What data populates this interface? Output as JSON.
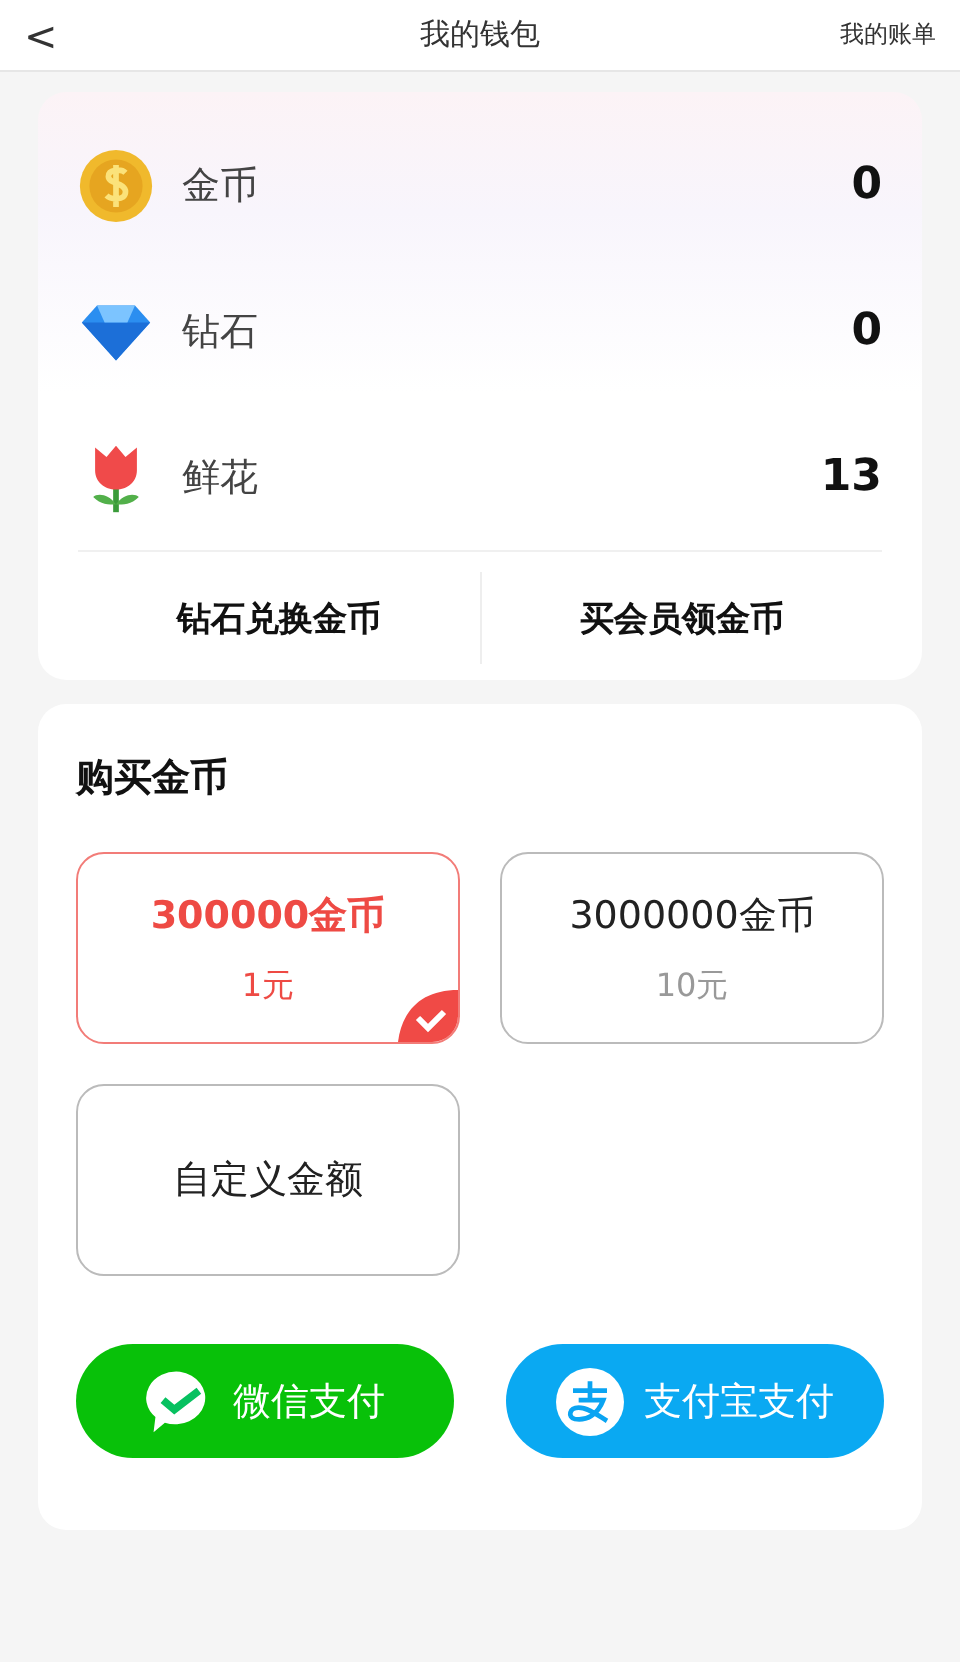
{
  "header": {
    "back": "<",
    "title": "我的钱包",
    "action": "我的账单"
  },
  "balances": [
    {
      "kind": "coin",
      "label": "金币",
      "value": "0"
    },
    {
      "kind": "diamond",
      "label": "钻石",
      "value": "0"
    },
    {
      "kind": "flower",
      "label": "鲜花",
      "value": "13"
    }
  ],
  "actions": [
    "钻石兑换金币",
    "买会员领金币"
  ],
  "purchase": {
    "title": "购买金币",
    "options": [
      {
        "kind": "amount",
        "amount": "300000金币",
        "price": "1元",
        "selected": true
      },
      {
        "kind": "amount",
        "amount": "3000000金币",
        "price": "10元",
        "selected": false
      },
      {
        "kind": "custom",
        "amount": "自定义金额",
        "selected": false
      }
    ],
    "payments": [
      {
        "kind": "wechat",
        "label": "微信支付"
      },
      {
        "kind": "alipay",
        "label": "支付宝支付"
      }
    ]
  }
}
